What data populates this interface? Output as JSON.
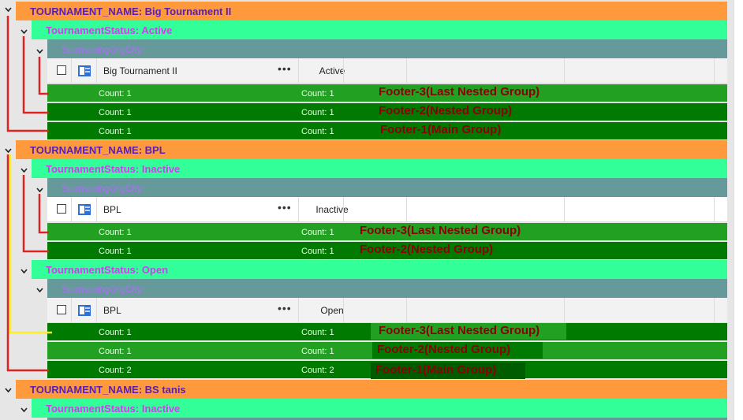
{
  "colors": {
    "group1": "#ff9a3c",
    "group2": "#33ff99",
    "group3": "#669999",
    "footer_light": "#22a022",
    "footer_dark": "#007a00",
    "annotation_text": "#8b0000",
    "connector_red": "#dd2222",
    "connector_yellow": "#ffee22"
  },
  "rows": {
    "g1_a": {
      "label": "TOURNAMENT_NAME: Big Tournament II"
    },
    "g2_a": {
      "label": "TournamentStatus: Active"
    },
    "g3_a": {
      "label": "SponsoringOrgCity:"
    },
    "d_a": {
      "name": "Big Tournament II",
      "more": "•••",
      "status": "Active"
    },
    "f_a1": {
      "count_left": "Count: 1",
      "count_right": "Count: 1",
      "note": "Footer-3(Last Nested Group)"
    },
    "f_a2": {
      "count_left": "Count: 1",
      "count_right": "Count: 1",
      "note": "Footer-2(Nested Group)"
    },
    "f_a3": {
      "count_left": "Count: 1",
      "count_right": "Count: 1",
      "note": "Footer-1(Main Group)"
    },
    "g1_b": {
      "label": "TOURNAMENT_NAME: BPL"
    },
    "g2_b": {
      "label": "TournamentStatus: Inactive"
    },
    "g3_b": {
      "label": "SponsoringOrgCity:"
    },
    "d_b": {
      "name": "BPL",
      "more": "•••",
      "status": "Inactive"
    },
    "f_b1": {
      "count_left": "Count: 1",
      "count_right": "Count: 1",
      "note": "Footer-3(Last Nested Group)"
    },
    "f_b2": {
      "count_left": "Count: 1",
      "count_right": "Count: 1",
      "note": "Footer-2(Nested Group)"
    },
    "g2_c": {
      "label": "TournamentStatus: Open"
    },
    "g3_c": {
      "label": "SponsoringOrgCity:"
    },
    "d_c": {
      "name": "BPL",
      "more": "•••",
      "status": "Open"
    },
    "f_c1": {
      "count_left": "Count: 1",
      "count_right": "Count: 1",
      "note": "Footer-3(Last Nested Group)"
    },
    "f_c2": {
      "count_left": "Count: 1",
      "count_right": "Count: 1",
      "note": "Footer-2(Nested Group)"
    },
    "f_c3": {
      "count_left": "Count: 2",
      "count_right": "Count: 2",
      "note": "Footer-1(Main Group)"
    },
    "g1_d": {
      "label": "TOURNAMENT_NAME: BS tanis"
    },
    "g2_d": {
      "label": "TournamentStatus: Inactive"
    }
  },
  "icons": {
    "chevron": "chevron-down-icon",
    "checkbox": "checkbox-icon",
    "row_icon": "tournament-icon"
  }
}
